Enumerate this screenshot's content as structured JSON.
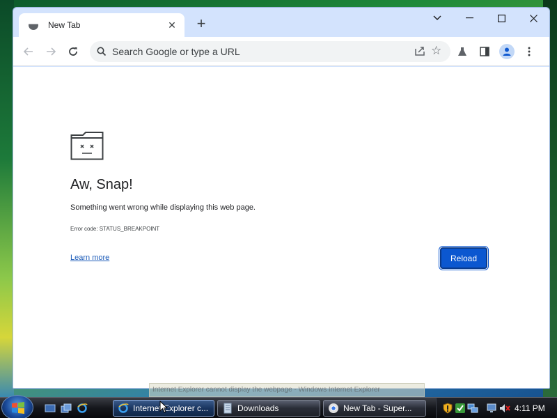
{
  "browser": {
    "tab": {
      "title": "New Tab",
      "close_glyph": "✕"
    },
    "new_tab_glyph": "+",
    "window_controls": {
      "menu": "⌄",
      "minimize": "—",
      "maximize": "☐",
      "close": "✕"
    },
    "omnibox": {
      "placeholder": "Search Google or type a URL"
    },
    "icons": [
      "back-icon",
      "forward-icon",
      "reload-icon",
      "search-icon",
      "share-icon",
      "bookmark-star-icon",
      "labs-flask-icon",
      "side-panel-icon",
      "profile-icon",
      "menu-dots-icon"
    ]
  },
  "error_page": {
    "heading": "Aw, Snap!",
    "message": "Something went wrong while displaying this web page.",
    "error_code": "Error code: STATUS_BREAKPOINT",
    "learn_more": "Learn more",
    "reload_button": "Reload"
  },
  "tooltip": {
    "text": "Internet Explorer cannot display the webpage - Windows Internet Explorer"
  },
  "taskbar": {
    "tasks": [
      {
        "label": "Internet Explorer c...",
        "icon": "ie-icon",
        "active": true
      },
      {
        "label": "Downloads",
        "icon": "folder-icon",
        "active": false
      },
      {
        "label": "New Tab - Super...",
        "icon": "chrome-icon",
        "active": false
      }
    ],
    "quick_launch": [
      "show-desktop-icon",
      "switch-windows-icon",
      "ie-quicklaunch-icon"
    ],
    "tray_icons": [
      "security-shield-icon",
      "update-icon",
      "network-icon",
      "volume-muted-icon"
    ],
    "clock": "4:11 PM"
  },
  "colors": {
    "accent": "#0b57d0",
    "tabstrip": "#d3e3fd",
    "link": "#1a5ab8"
  }
}
